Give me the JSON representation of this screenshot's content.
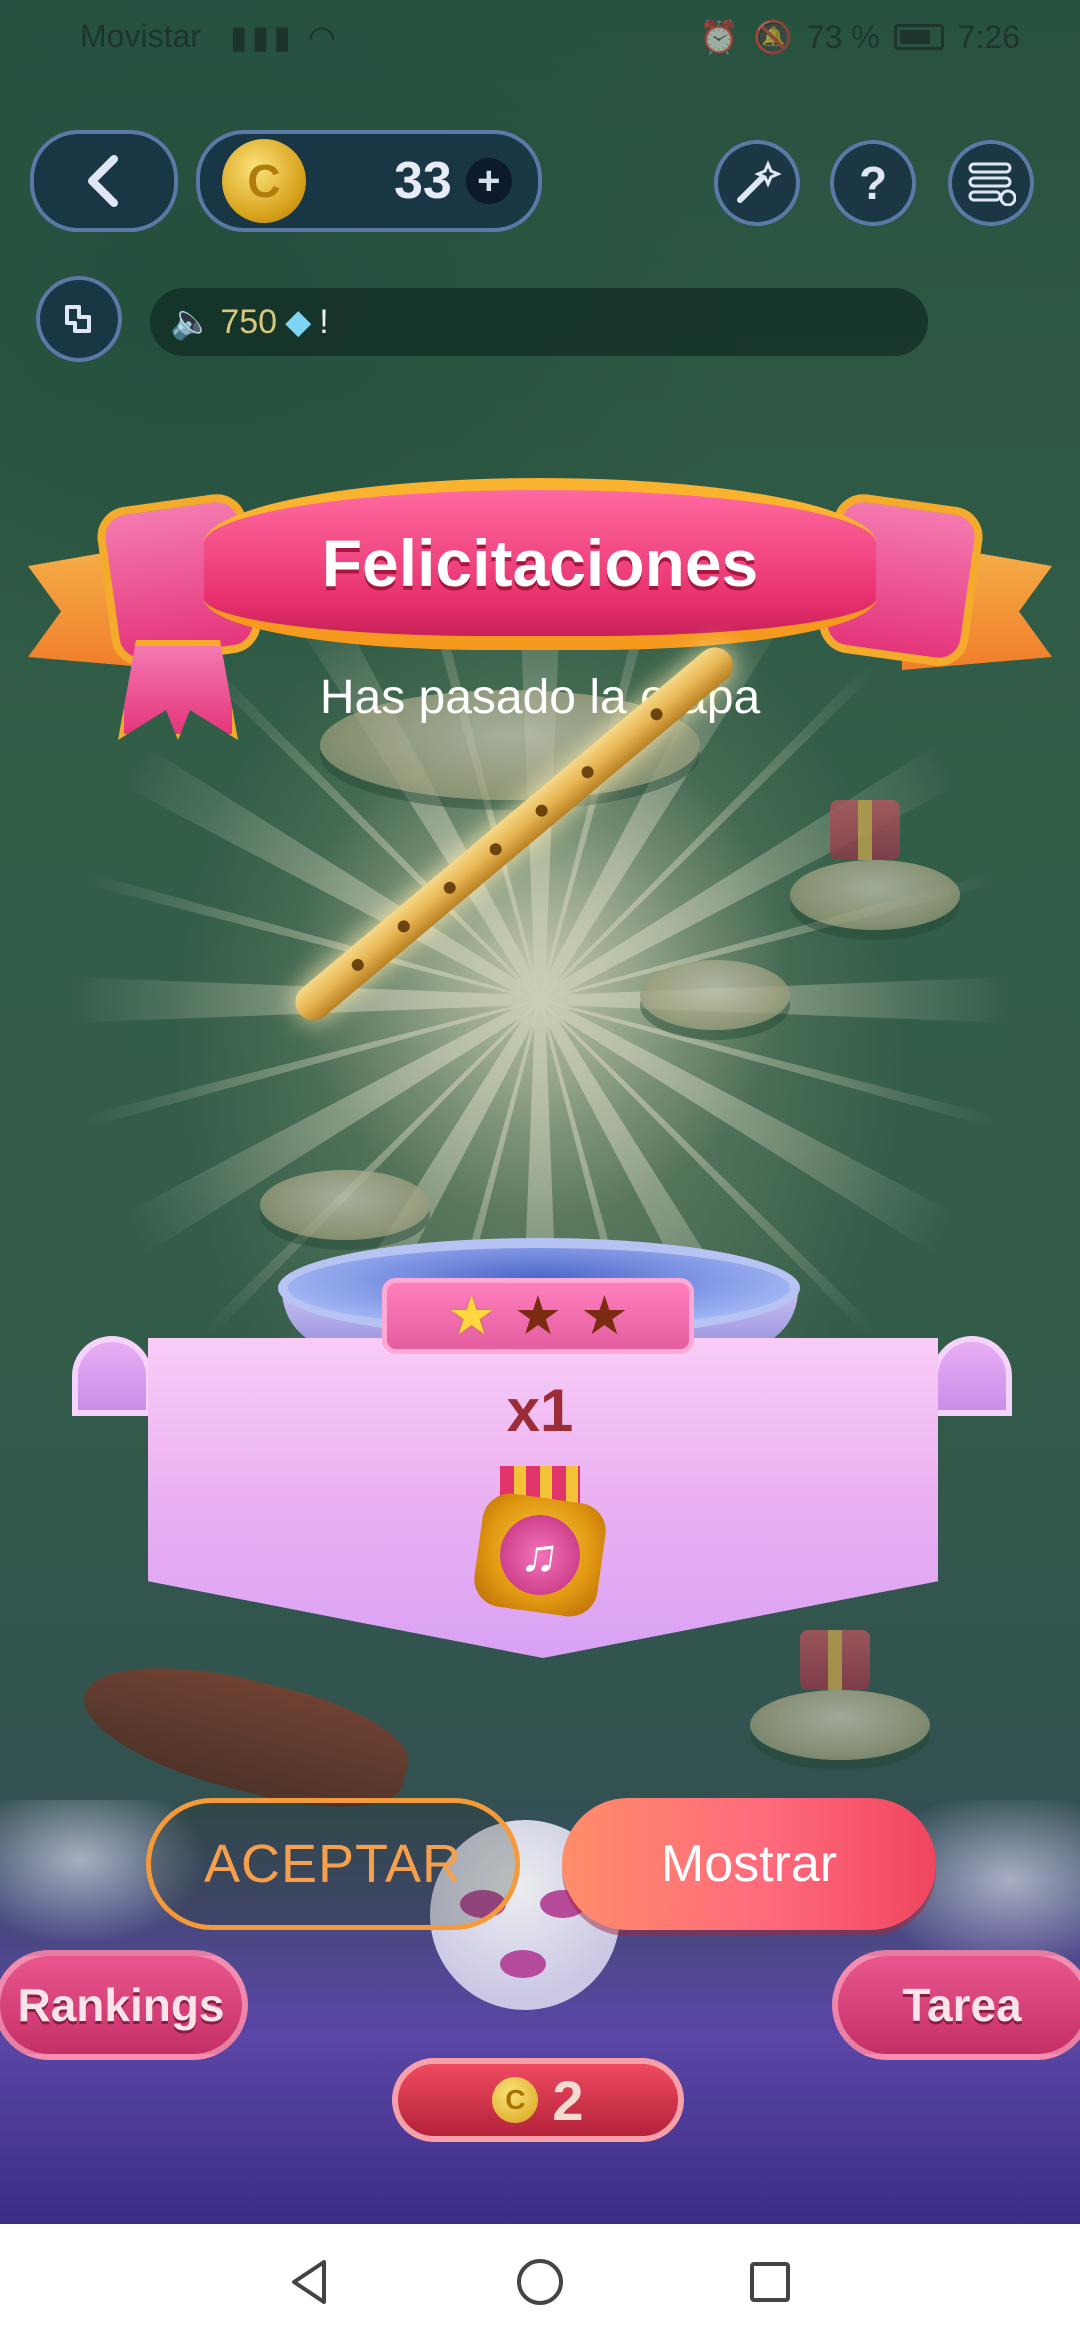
{
  "status_bar": {
    "carrier": "Movistar",
    "battery": "73 %",
    "time": "7:26"
  },
  "hud": {
    "back_icon": "chevron-left-icon",
    "coins": "33",
    "coin_symbol": "C",
    "plus": "+",
    "help": "?",
    "ticker_amount": "750",
    "ticker_suffix": "!"
  },
  "dialog": {
    "title": "Felicitaciones",
    "subtitle": "Has pasado la etapa",
    "stars_earned": 1,
    "stars_total": 3,
    "reward_count": "x1",
    "reward_icon": "music-medal-icon",
    "accept_label": "ACEPTAR",
    "show_label": "Mostrar"
  },
  "bottom": {
    "rankings_label": "Rankings",
    "task_label": "Tarea",
    "play_cost": "2",
    "coin_symbol": "C"
  },
  "colors": {
    "ribbon": "#e8316f",
    "accept_border": "#f59a3a",
    "show_button": "#ff6a7c",
    "banner": "#eab1f2"
  }
}
